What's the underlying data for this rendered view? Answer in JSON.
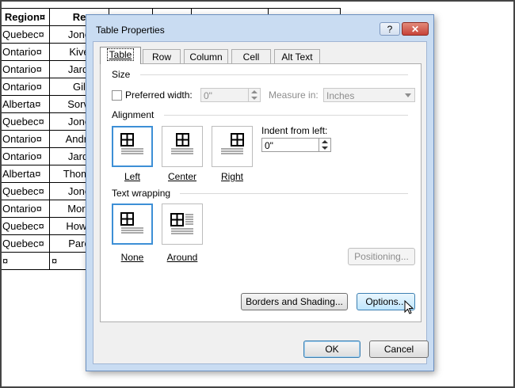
{
  "background_table": {
    "headers": [
      "Region¤",
      "Re"
    ],
    "rows": [
      [
        "Quebec¤",
        "Jone"
      ],
      [
        "Ontario¤",
        "Kive"
      ],
      [
        "Ontario¤",
        "Jardi"
      ],
      [
        "Ontario¤",
        "Gil"
      ],
      [
        "Alberta¤",
        "Sorvi"
      ],
      [
        "Quebec¤",
        "Jone"
      ],
      [
        "Ontario¤",
        "Andre"
      ],
      [
        "Ontario¤",
        "Jardi"
      ],
      [
        "Alberta¤",
        "Thomp"
      ],
      [
        "Quebec¤",
        "Jone"
      ],
      [
        "Ontario¤",
        "Morg"
      ],
      [
        "Quebec¤",
        "Howa"
      ],
      [
        "Quebec¤",
        "Pare"
      ],
      [
        "¤",
        "¤"
      ]
    ]
  },
  "dialog": {
    "title": "Table Properties",
    "help_label": "?",
    "close_label": "✕",
    "tabs": [
      {
        "label": "Table",
        "active": true
      },
      {
        "label": "Row"
      },
      {
        "label": "Column"
      },
      {
        "label": "Cell"
      },
      {
        "label": "Alt Text"
      }
    ],
    "size": {
      "heading": "Size",
      "preferred_width_label": "Preferred width:",
      "preferred_width_value": "0\"",
      "measure_in_label": "Measure in:",
      "measure_in_value": "Inches"
    },
    "alignment": {
      "heading": "Alignment",
      "options": [
        {
          "label": "Left",
          "selected": true
        },
        {
          "label": "Center"
        },
        {
          "label": "Right"
        }
      ],
      "indent_label": "Indent from left:",
      "indent_value": "0\""
    },
    "wrapping": {
      "heading": "Text wrapping",
      "options": [
        {
          "label": "None",
          "selected": true
        },
        {
          "label": "Around"
        }
      ],
      "positioning_label": "Positioning..."
    },
    "borders_label": "Borders and Shading...",
    "options_label": "Options...",
    "ok_label": "OK",
    "cancel_label": "Cancel"
  }
}
